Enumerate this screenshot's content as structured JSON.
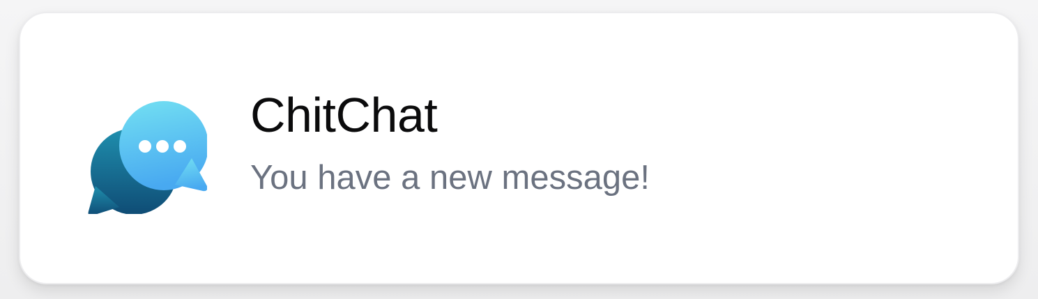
{
  "notification": {
    "app_name": "ChitChat",
    "message": "You have a new message!",
    "icon": "chat-bubbles-icon",
    "colors": {
      "title": "#0b0b0c",
      "message": "#6b7280",
      "icon_front_top": "#6fdcf0",
      "icon_front_bottom": "#4aaef0",
      "icon_back_top": "#1e8aa8",
      "icon_back_bottom": "#0f4f78",
      "dots": "#ffffff"
    }
  }
}
